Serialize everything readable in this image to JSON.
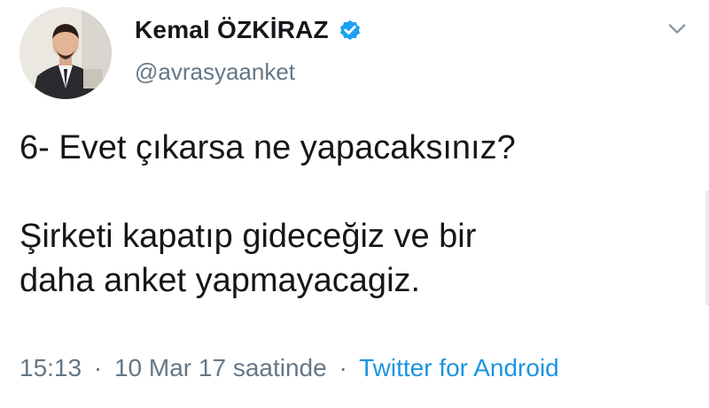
{
  "author": {
    "display_name": "Kemal ÖZKİRAZ",
    "handle": "@avrasyaanket",
    "verified": true
  },
  "tweet": {
    "line1": "6- Evet çıkarsa ne yapacaksınız?",
    "line2": "Şirketi kapatıp gideceğiz ve bir",
    "line3": "daha anket yapmayacagiz."
  },
  "meta": {
    "time": "15:13",
    "separator": "·",
    "date": "10 Mar 17 saatinde",
    "source": "Twitter for Android"
  },
  "icons": {
    "avatar": "profile-photo",
    "verified": "verified-badge-icon",
    "menu": "chevron-down-icon"
  },
  "colors": {
    "text": "#14171a",
    "secondary": "#657786",
    "link": "#1b95e0",
    "verified": "#1da1f2"
  }
}
